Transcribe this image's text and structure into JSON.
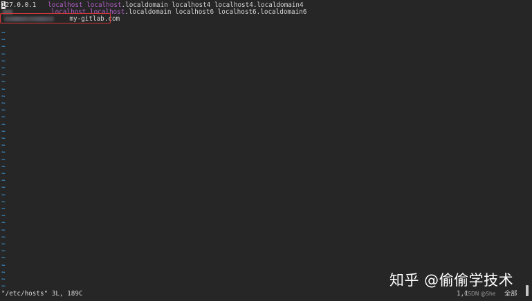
{
  "editor": {
    "lines": [
      {
        "ip_first_char": "1",
        "ip_rest": "27.0.0.1",
        "names": [
          "localhost",
          "localhost",
          ".localdomain localhost4 localhost4.localdomain4"
        ]
      },
      {
        "names": [
          "localhost",
          "localhost",
          ".localdomain localhost6 localhost6.localdomain6"
        ]
      },
      {
        "hostname": "my-gitlab.com"
      }
    ],
    "tilde": "~",
    "tilde_count": 37
  },
  "status": {
    "file_info": "\"/etc/hosts\" 3L, 189C",
    "position": "1,1",
    "scroll": "全部"
  },
  "watermark": {
    "zhihu": "知乎 @偷偷学技术",
    "csdn": "CSDN @She"
  },
  "colors": {
    "background": "#262626",
    "keyword": "#b25fc7",
    "tilde": "#3e8fc9",
    "highlight_border": "#d8383a"
  }
}
